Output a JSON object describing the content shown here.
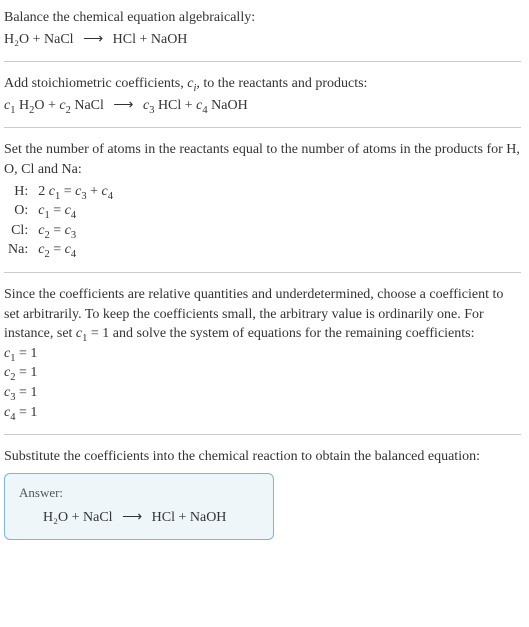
{
  "title_prefix": "Balance the chemical equation algebraically:",
  "main_equation": {
    "lhs": "H₂O + NaCl",
    "arrow": "⟶",
    "rhs": "HCl + NaOH"
  },
  "stoich_text_part1": "Add stoichiometric coefficients, ",
  "stoich_text_ci": "c",
  "stoich_text_ci_sub": "i",
  "stoich_text_part2": ", to the reactants and products:",
  "coeff_equation": {
    "c1": "c",
    "c1s": "1",
    "t1": " H",
    "t1s": "2",
    "t1b": "O + ",
    "c2": "c",
    "c2s": "2",
    "t2": " NaCl ",
    "arrow": "⟶",
    "c3": " c",
    "c3s": "3",
    "t3": " HCl + ",
    "c4": "c",
    "c4s": "4",
    "t4": " NaOH"
  },
  "balance_text": "Set the number of atoms in the reactants equal to the number of atoms in the products for H, O, Cl and Na:",
  "atom_equations": [
    {
      "label": "H:",
      "lhs_pre": "2 ",
      "lhs_c": "c",
      "lhs_s": "1",
      "eq": " = ",
      "rhs1_c": "c",
      "rhs1_s": "3",
      "plus": " + ",
      "rhs2_c": "c",
      "rhs2_s": "4"
    },
    {
      "label": "O:",
      "lhs_pre": "",
      "lhs_c": "c",
      "lhs_s": "1",
      "eq": " = ",
      "rhs1_c": "c",
      "rhs1_s": "4",
      "plus": "",
      "rhs2_c": "",
      "rhs2_s": ""
    },
    {
      "label": "Cl:",
      "lhs_pre": "",
      "lhs_c": "c",
      "lhs_s": "2",
      "eq": " = ",
      "rhs1_c": "c",
      "rhs1_s": "3",
      "plus": "",
      "rhs2_c": "",
      "rhs2_s": ""
    },
    {
      "label": "Na:",
      "lhs_pre": "",
      "lhs_c": "c",
      "lhs_s": "2",
      "eq": " = ",
      "rhs1_c": "c",
      "rhs1_s": "4",
      "plus": "",
      "rhs2_c": "",
      "rhs2_s": ""
    }
  ],
  "solve_text_part1": "Since the coefficients are relative quantities and underdetermined, choose a coefficient to set arbitrarily. To keep the coefficients small, the arbitrary value is ordinarily one. For instance, set ",
  "solve_c": "c",
  "solve_cs": "1",
  "solve_text_part2": " = 1 and solve the system of equations for the remaining coefficients:",
  "solutions": [
    {
      "c": "c",
      "s": "1",
      "eq": " = 1"
    },
    {
      "c": "c",
      "s": "2",
      "eq": " = 1"
    },
    {
      "c": "c",
      "s": "3",
      "eq": " = 1"
    },
    {
      "c": "c",
      "s": "4",
      "eq": " = 1"
    }
  ],
  "substitute_text": "Substitute the coefficients into the chemical reaction to obtain the balanced equation:",
  "answer_label": "Answer:",
  "answer_equation": {
    "lhs": "H₂O + NaCl",
    "arrow": "⟶",
    "rhs": "HCl + NaOH"
  },
  "chart_data": {
    "type": "table",
    "title": "Balance chemical equation",
    "unbalanced": "H2O + NaCl -> HCl + NaOH",
    "with_coefficients": "c1 H2O + c2 NaCl -> c3 HCl + c4 NaOH",
    "atom_balance": {
      "H": "2 c1 = c3 + c4",
      "O": "c1 = c4",
      "Cl": "c2 = c3",
      "Na": "c2 = c4"
    },
    "set": "c1 = 1",
    "solution": {
      "c1": 1,
      "c2": 1,
      "c3": 1,
      "c4": 1
    },
    "balanced": "H2O + NaCl -> HCl + NaOH"
  }
}
